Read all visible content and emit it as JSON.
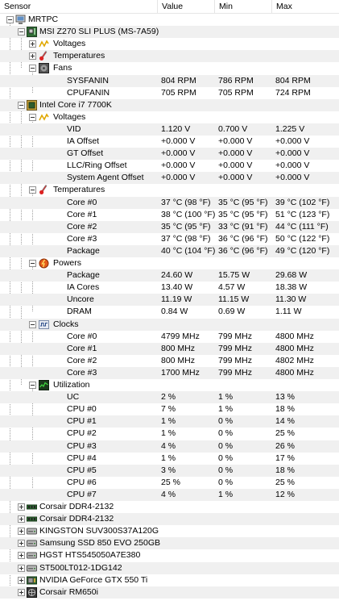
{
  "columns": {
    "sensor": "Sensor",
    "value": "Value",
    "min": "Min",
    "max": "Max"
  },
  "rows": [
    {
      "label": "MRTPC",
      "level": 0,
      "exp": "minus",
      "icon": "computer-icon"
    },
    {
      "label": "MSI Z270 SLI PLUS (MS-7A59)",
      "level": 1,
      "exp": "minus",
      "icon": "motherboard-icon"
    },
    {
      "label": "Voltages",
      "level": 2,
      "exp": "plus",
      "icon": "voltage-icon"
    },
    {
      "label": "Temperatures",
      "level": 2,
      "exp": "plus",
      "icon": "thermometer-icon"
    },
    {
      "label": "Fans",
      "level": 2,
      "exp": "minus",
      "icon": "fan-icon"
    },
    {
      "label": "SYSFANIN",
      "level": 3,
      "value": "804 RPM",
      "min": "786 RPM",
      "max": "804 RPM"
    },
    {
      "label": "CPUFANIN",
      "level": 3,
      "value": "705 RPM",
      "min": "705 RPM",
      "max": "724 RPM"
    },
    {
      "label": "Intel Core i7 7700K",
      "level": 1,
      "exp": "minus",
      "icon": "cpu-icon"
    },
    {
      "label": "Voltages",
      "level": 2,
      "exp": "minus",
      "icon": "voltage-icon"
    },
    {
      "label": "VID",
      "level": 3,
      "value": "1.120 V",
      "min": "0.700 V",
      "max": "1.225 V"
    },
    {
      "label": "IA Offset",
      "level": 3,
      "value": "+0.000 V",
      "min": "+0.000 V",
      "max": "+0.000 V"
    },
    {
      "label": "GT Offset",
      "level": 3,
      "value": "+0.000 V",
      "min": "+0.000 V",
      "max": "+0.000 V"
    },
    {
      "label": "LLC/Ring Offset",
      "level": 3,
      "value": "+0.000 V",
      "min": "+0.000 V",
      "max": "+0.000 V"
    },
    {
      "label": "System Agent Offset",
      "level": 3,
      "value": "+0.000 V",
      "min": "+0.000 V",
      "max": "+0.000 V"
    },
    {
      "label": "Temperatures",
      "level": 2,
      "exp": "minus",
      "icon": "thermometer-icon"
    },
    {
      "label": "Core #0",
      "level": 3,
      "value": "37 °C  (98 °F)",
      "min": "35 °C  (95 °F)",
      "max": "39 °C  (102 °F)"
    },
    {
      "label": "Core #1",
      "level": 3,
      "value": "38 °C  (100 °F)",
      "min": "35 °C  (95 °F)",
      "max": "51 °C  (123 °F)"
    },
    {
      "label": "Core #2",
      "level": 3,
      "value": "35 °C  (95 °F)",
      "min": "33 °C  (91 °F)",
      "max": "44 °C  (111 °F)"
    },
    {
      "label": "Core #3",
      "level": 3,
      "value": "37 °C  (98 °F)",
      "min": "36 °C  (96 °F)",
      "max": "50 °C  (122 °F)"
    },
    {
      "label": "Package",
      "level": 3,
      "value": "40 °C  (104 °F)",
      "min": "36 °C  (96 °F)",
      "max": "49 °C  (120 °F)"
    },
    {
      "label": "Powers",
      "level": 2,
      "exp": "minus",
      "icon": "power-icon"
    },
    {
      "label": "Package",
      "level": 3,
      "value": "24.60 W",
      "min": "15.75 W",
      "max": "29.68 W"
    },
    {
      "label": "IA Cores",
      "level": 3,
      "value": "13.40 W",
      "min": "4.57 W",
      "max": "18.38 W"
    },
    {
      "label": "Uncore",
      "level": 3,
      "value": "11.19 W",
      "min": "11.15 W",
      "max": "11.30 W"
    },
    {
      "label": "DRAM",
      "level": 3,
      "value": "0.84 W",
      "min": "0.69 W",
      "max": "1.11 W"
    },
    {
      "label": "Clocks",
      "level": 2,
      "exp": "minus",
      "icon": "clock-icon"
    },
    {
      "label": "Core #0",
      "level": 3,
      "value": "4799 MHz",
      "min": "799 MHz",
      "max": "4800 MHz"
    },
    {
      "label": "Core #1",
      "level": 3,
      "value": "800 MHz",
      "min": "799 MHz",
      "max": "4800 MHz"
    },
    {
      "label": "Core #2",
      "level": 3,
      "value": "800 MHz",
      "min": "799 MHz",
      "max": "4802 MHz"
    },
    {
      "label": "Core #3",
      "level": 3,
      "value": "1700 MHz",
      "min": "799 MHz",
      "max": "4800 MHz"
    },
    {
      "label": "Utilization",
      "level": 2,
      "exp": "minus",
      "icon": "utilization-icon"
    },
    {
      "label": "UC",
      "level": 3,
      "value": "2 %",
      "min": "1 %",
      "max": "13 %"
    },
    {
      "label": "CPU #0",
      "level": 3,
      "value": "7 %",
      "min": "1 %",
      "max": "18 %"
    },
    {
      "label": "CPU #1",
      "level": 3,
      "value": "1 %",
      "min": "0 %",
      "max": "14 %"
    },
    {
      "label": "CPU #2",
      "level": 3,
      "value": "1 %",
      "min": "0 %",
      "max": "25 %"
    },
    {
      "label": "CPU #3",
      "level": 3,
      "value": "4 %",
      "min": "0 %",
      "max": "26 %"
    },
    {
      "label": "CPU #4",
      "level": 3,
      "value": "1 %",
      "min": "0 %",
      "max": "17 %"
    },
    {
      "label": "CPU #5",
      "level": 3,
      "value": "3 %",
      "min": "0 %",
      "max": "18 %"
    },
    {
      "label": "CPU #6",
      "level": 3,
      "value": "25 %",
      "min": "0 %",
      "max": "25 %"
    },
    {
      "label": "CPU #7",
      "level": 3,
      "value": "4 %",
      "min": "1 %",
      "max": "12 %"
    },
    {
      "label": "Corsair DDR4-2132",
      "level": 1,
      "exp": "plus",
      "icon": "memory-icon"
    },
    {
      "label": "Corsair DDR4-2132",
      "level": 1,
      "exp": "plus",
      "icon": "memory-icon"
    },
    {
      "label": "KINGSTON SUV300S37A120G",
      "level": 1,
      "exp": "plus",
      "icon": "drive-icon"
    },
    {
      "label": "Samsung SSD 850 EVO 250GB",
      "level": 1,
      "exp": "plus",
      "icon": "drive-icon"
    },
    {
      "label": "HGST HTS545050A7E380",
      "level": 1,
      "exp": "plus",
      "icon": "drive-icon"
    },
    {
      "label": "ST500LT012-1DG142",
      "level": 1,
      "exp": "plus",
      "icon": "drive-icon"
    },
    {
      "label": "NVIDIA GeForce GTX 550 Ti",
      "level": 1,
      "exp": "plus",
      "icon": "gpu-icon"
    },
    {
      "label": "Corsair RM650i",
      "level": 1,
      "exp": "plus",
      "icon": "psu-icon"
    }
  ]
}
